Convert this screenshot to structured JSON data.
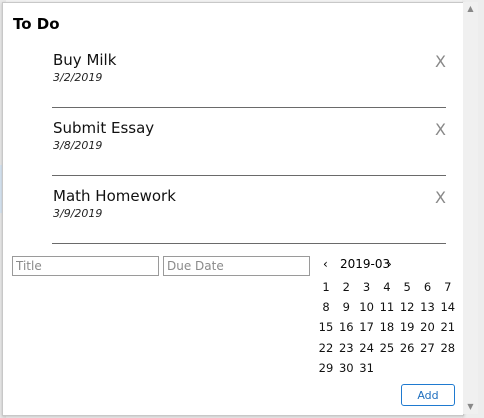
{
  "header": {
    "title": "To Do"
  },
  "todos": [
    {
      "title": "Buy Milk",
      "date": "3/2/2019",
      "remove": "X"
    },
    {
      "title": "Submit Essay",
      "date": "3/8/2019",
      "remove": "X"
    },
    {
      "title": "Math Homework",
      "date": "3/9/2019",
      "remove": "X"
    }
  ],
  "form": {
    "title_placeholder": "Title",
    "due_date_placeholder": "Due Date",
    "add_label": "Add"
  },
  "calendar": {
    "prev": "‹",
    "month": "2019-03",
    "next": "›",
    "days": [
      "1",
      "2",
      "3",
      "4",
      "5",
      "6",
      "7",
      "8",
      "9",
      "10",
      "11",
      "12",
      "13",
      "14",
      "15",
      "16",
      "17",
      "18",
      "19",
      "20",
      "21",
      "22",
      "23",
      "24",
      "25",
      "26",
      "27",
      "28",
      "29",
      "30",
      "31"
    ]
  },
  "icons": {
    "scroll_up": "scroll-up-arrow-icon",
    "scroll_down": "scroll-down-arrow-icon"
  },
  "colors": {
    "accent": "#1f7ad0"
  }
}
